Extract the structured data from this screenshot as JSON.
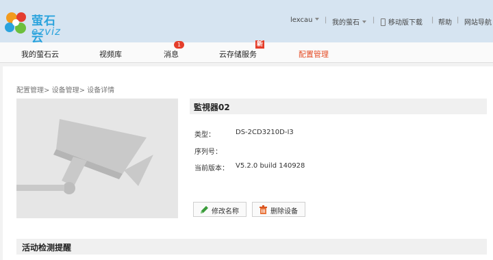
{
  "brand": {
    "name_cn": "萤石云",
    "name_en": "ezviz"
  },
  "topnav": {
    "username": "lexcau",
    "my_ezviz": "我的萤石",
    "mobile_download": "移动版下载",
    "help": "帮助",
    "site_nav": "网站导航"
  },
  "mainnav": {
    "tabs": [
      {
        "label": "我的萤石云"
      },
      {
        "label": "视频库"
      },
      {
        "label": "消息",
        "badge": "1"
      },
      {
        "label": "云存储服务",
        "tag": "新"
      },
      {
        "label": "配置管理",
        "active": true
      }
    ]
  },
  "breadcrumb": {
    "level1": "配置管理",
    "level2": "设备管理",
    "level3": "设备详情",
    "separator": ">"
  },
  "device": {
    "name": "監視器02",
    "fields": [
      {
        "label": "类型：",
        "value": "DS-2CD3210D-I3"
      },
      {
        "label": "序列号：",
        "value": ""
      },
      {
        "label": "当前版本：",
        "value": "V5.2.0 build 140928"
      }
    ],
    "rename_button": "修改名称",
    "delete_button": "删除设备"
  },
  "section": {
    "motion_detection_title": "活动检测提醒"
  },
  "colors": {
    "header_bg": "#d6e4f1",
    "accent": "#e54d26",
    "badge": "#e53e2b",
    "brand": "#2aa3dd"
  }
}
